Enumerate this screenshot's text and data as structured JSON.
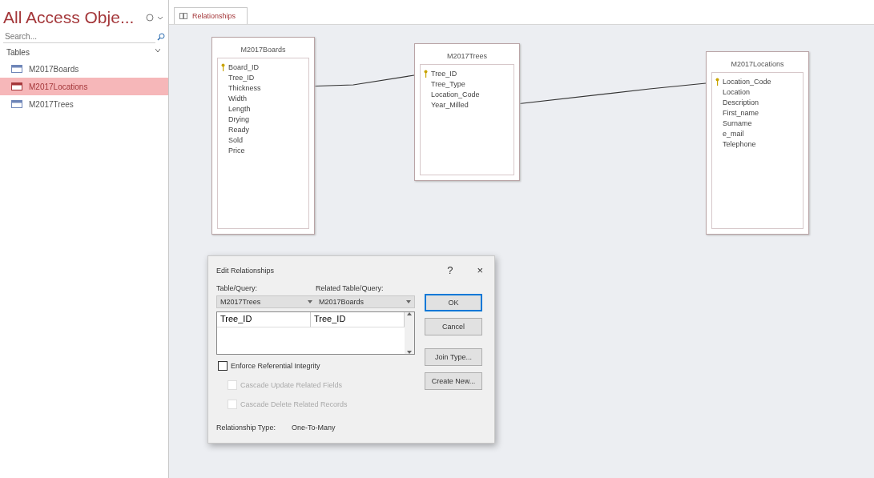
{
  "navigation_pane": {
    "title": "All Access Obje...",
    "search": {
      "placeholder": "Search..."
    },
    "group": "Tables",
    "items": [
      {
        "label": "M2017Boards",
        "selected": false
      },
      {
        "label": "M2017Locations",
        "selected": true
      },
      {
        "label": "M2017Trees",
        "selected": false
      }
    ]
  },
  "tabs": [
    {
      "label": "Relationships",
      "selected": true
    }
  ],
  "tables": [
    {
      "title": "M2017Boards",
      "fields": [
        {
          "name": "Board_ID",
          "key": true
        },
        {
          "name": "Tree_ID",
          "key": false
        },
        {
          "name": "Thickness",
          "key": false
        },
        {
          "name": "Width",
          "key": false
        },
        {
          "name": "Length",
          "key": false
        },
        {
          "name": "Drying",
          "key": false
        },
        {
          "name": "Ready",
          "key": false
        },
        {
          "name": "Sold",
          "key": false
        },
        {
          "name": "Price",
          "key": false
        }
      ]
    },
    {
      "title": "M2017Trees",
      "fields": [
        {
          "name": "Tree_ID",
          "key": true
        },
        {
          "name": "Tree_Type",
          "key": false
        },
        {
          "name": "Location_Code",
          "key": false
        },
        {
          "name": "Year_Milled",
          "key": false
        }
      ]
    },
    {
      "title": "M2017Locations",
      "fields": [
        {
          "name": "Location_Code",
          "key": true
        },
        {
          "name": "Location",
          "key": false
        },
        {
          "name": "Description",
          "key": false
        },
        {
          "name": "First_name",
          "key": false
        },
        {
          "name": "Surname",
          "key": false
        },
        {
          "name": "e_mail",
          "key": false
        },
        {
          "name": "Telephone",
          "key": false
        }
      ]
    }
  ],
  "dialog": {
    "title": "Edit Relationships",
    "help": "?",
    "close": "×",
    "table_label": "Table/Query:",
    "related_label": "Related Table/Query:",
    "table": "M2017Trees",
    "related_table": "M2017Boards",
    "field_pairs": [
      {
        "field": "Tree_ID",
        "related_field": "Tree_ID"
      }
    ],
    "options": [
      {
        "label": "Enforce Referential Integrity",
        "checked": false,
        "disabled": false
      },
      {
        "label": "Cascade Update Related Fields",
        "checked": false,
        "disabled": true
      },
      {
        "label": "Cascade Delete Related Records",
        "checked": false,
        "disabled": true
      }
    ],
    "type_label": "Relationship Type:",
    "type_value": "One-To-Many",
    "buttons": [
      {
        "label": "OK",
        "default": true
      },
      {
        "label": "Cancel",
        "default": false
      },
      {
        "label": "Join Type...",
        "default": false
      },
      {
        "label": "Create New...",
        "default": false
      }
    ]
  }
}
